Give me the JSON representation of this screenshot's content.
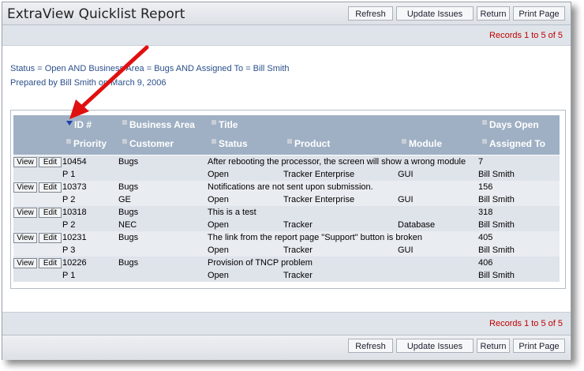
{
  "header": {
    "title": "ExtraView Quicklist Report",
    "buttons": [
      "Refresh",
      "Update Issues",
      "Return",
      "Print Page"
    ]
  },
  "records_text": "Records 1 to 5 of 5",
  "filter": {
    "criteria": "Status = Open AND Business Area = Bugs AND Assigned To = Bill Smith",
    "prepared": "Prepared by Bill Smith on March 9, 2006"
  },
  "columns": {
    "row1": [
      "ID #",
      "Business Area",
      "Title",
      "Days Open"
    ],
    "row2": [
      "Priority",
      "Customer",
      "Status",
      "Product",
      "Module",
      "Assigned To"
    ]
  },
  "row_buttons": {
    "view": "View",
    "edit": "Edit"
  },
  "rows": [
    {
      "id": "10454",
      "area": "Bugs",
      "title": "After rebooting the processor, the screen will show a wrong module",
      "days": "7",
      "priority": "P 1",
      "customer": "",
      "status": "Open",
      "product": "Tracker Enterprise",
      "module": "GUI",
      "assigned": "Bill Smith"
    },
    {
      "id": "10373",
      "area": "Bugs",
      "title": "Notifications are not sent upon submission.",
      "days": "156",
      "priority": "P 2",
      "customer": "GE",
      "status": "Open",
      "product": "Tracker Enterprise",
      "module": "GUI",
      "assigned": "Bill Smith"
    },
    {
      "id": "10318",
      "area": "Bugs",
      "title": "This is a test",
      "days": "318",
      "priority": "P 2",
      "customer": "NEC",
      "status": "Open",
      "product": "Tracker",
      "module": "Database",
      "assigned": "Bill Smith"
    },
    {
      "id": "10231",
      "area": "Bugs",
      "title": "The link from the report page \"Support\" button is broken",
      "days": "405",
      "priority": "P 3",
      "customer": "",
      "status": "Open",
      "product": "Tracker",
      "module": "GUI",
      "assigned": "Bill Smith"
    },
    {
      "id": "10226",
      "area": "Bugs",
      "title": "Provision of TNCP problem",
      "days": "406",
      "priority": "P 1",
      "customer": "",
      "status": "Open",
      "product": "Tracker",
      "module": "",
      "assigned": "Bill Smith"
    }
  ],
  "colors": {
    "header_bg": "#9fb0c4",
    "records_red": "#c00000",
    "arrow_red": "#e01010",
    "sort_arrow": "#1e3fb0"
  }
}
